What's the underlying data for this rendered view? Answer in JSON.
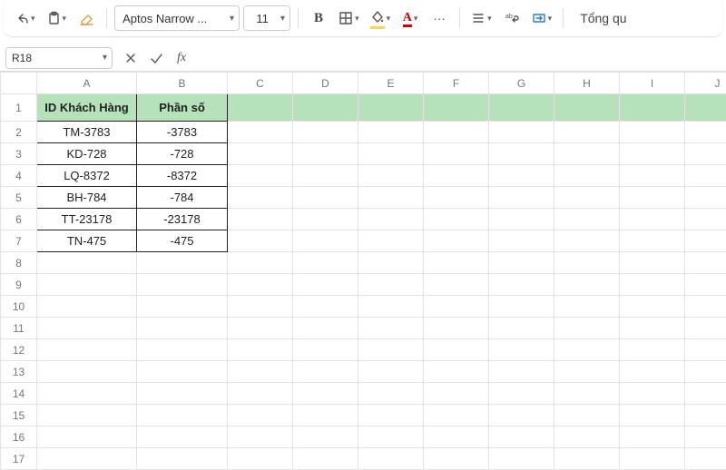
{
  "toolbar": {
    "font_name": "Aptos Narrow ...",
    "font_size": "11",
    "right_label": "Tổng qu"
  },
  "formula_bar": {
    "cell_ref": "R18",
    "formula": ""
  },
  "grid": {
    "columns": [
      "A",
      "B",
      "C",
      "D",
      "E",
      "F",
      "G",
      "H",
      "I",
      "J"
    ],
    "header_row": [
      "ID Khách Hàng",
      "Phần số"
    ],
    "data_rows": [
      [
        "TM-3783",
        "-3783"
      ],
      [
        "KD-728",
        "-728"
      ],
      [
        "LQ-8372",
        "-8372"
      ],
      [
        "BH-784",
        "-784"
      ],
      [
        "TT-23178",
        "-23178"
      ],
      [
        "TN-475",
        "-475"
      ]
    ],
    "row_count": 17
  }
}
